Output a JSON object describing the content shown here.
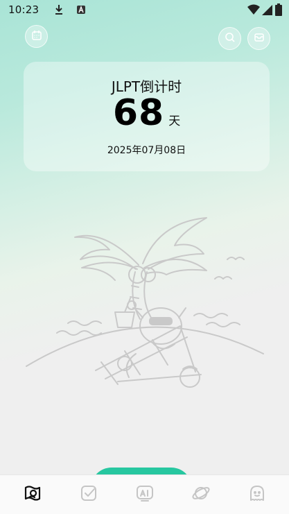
{
  "status_bar": {
    "time": "10:23",
    "icons": [
      "download-icon",
      "a-badge-icon",
      "wifi-icon",
      "signal-icon",
      "battery-icon"
    ]
  },
  "header": {
    "left_icon": "calendar-icon",
    "right_icons": [
      "search-icon",
      "inbox-icon"
    ]
  },
  "countdown_card": {
    "title": "JLPT倒计时",
    "days": "68",
    "unit": "天",
    "date": "2025年07月08日"
  },
  "illustration": "beach-palm-relax-illustration",
  "tab_bar": {
    "items": [
      {
        "icon": "photo-card-icon",
        "active": true
      },
      {
        "icon": "checkbox-icon",
        "active": false
      },
      {
        "icon": "ai-icon",
        "active": false
      },
      {
        "icon": "planet-icon",
        "active": false
      },
      {
        "icon": "ghost-icon",
        "active": false
      }
    ]
  },
  "colors": {
    "accent": "#27c7a0",
    "gradient_top": "#a9e4d6",
    "background": "#efefef"
  }
}
